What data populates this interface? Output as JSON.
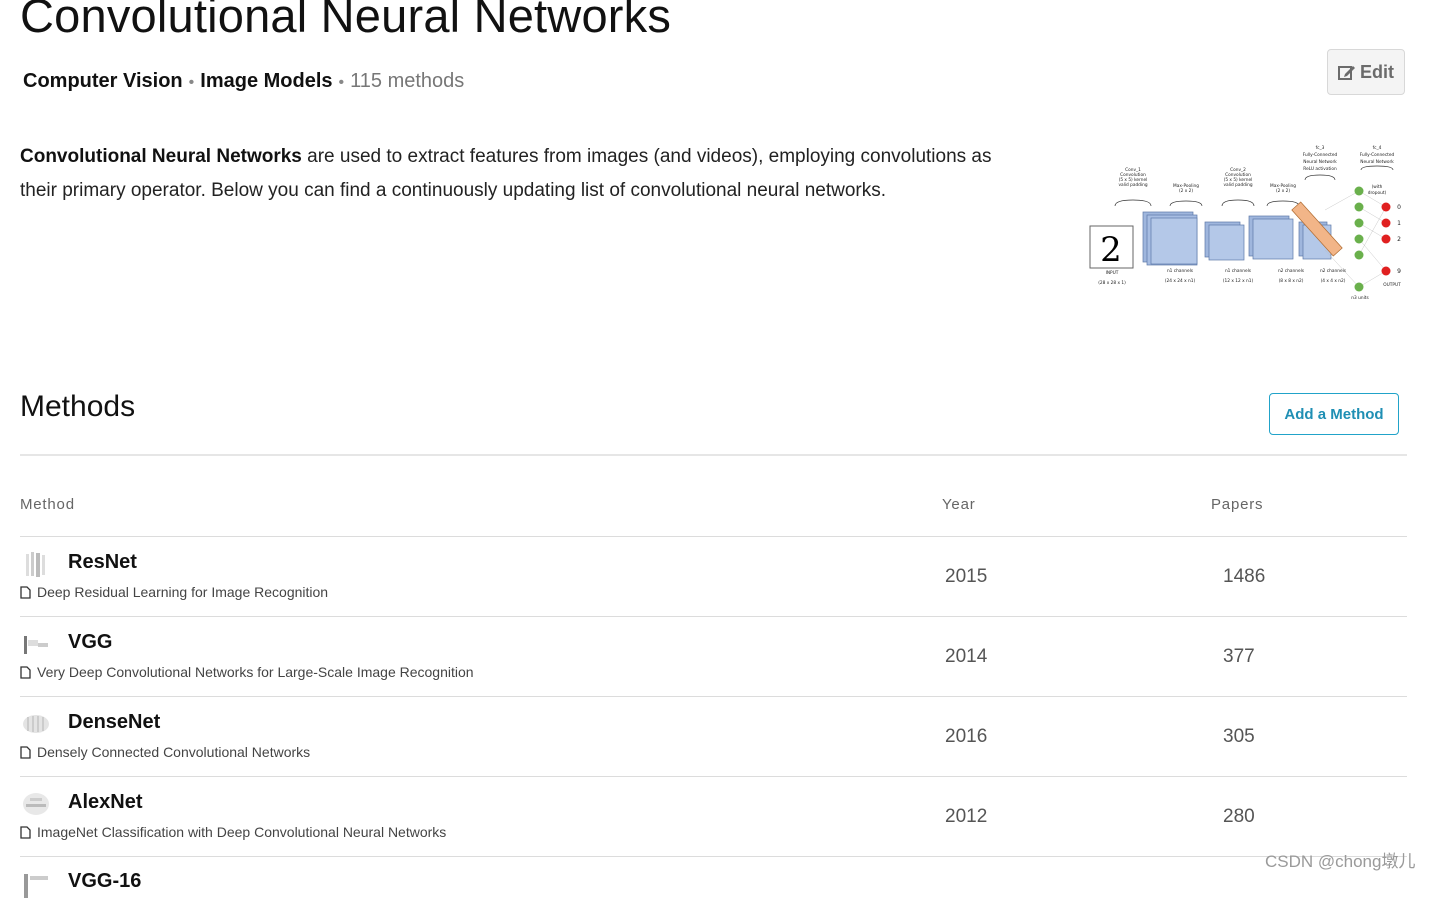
{
  "page": {
    "title": "Convolutional Neural Networks",
    "breadcrumb": [
      "Computer Vision",
      "Image Models"
    ],
    "method_count": "115 methods",
    "edit_label": "Edit"
  },
  "description": {
    "bold": "Convolutional Neural Networks",
    "text": " are used to extract features from images (and videos), employing convolutions as their primary operator. Below you can find a continuously updating list of convolutional neural networks."
  },
  "diagram": {
    "labels": [
      "Conv_1",
      "Convolution",
      "(5 x 5) kernel",
      "valid padding",
      "Max-Pooling",
      "(2 x 2)",
      "Conv_2",
      "Convolution",
      "(5 x 5) kernel",
      "valid padding",
      "Max-Pooling",
      "(2 x 2)",
      "fc_3",
      "Fully-Connected",
      "Neural Network",
      "ReLU activation",
      "fc_4",
      "Fully-Connected",
      "Neural Network",
      "(with",
      "dropout)",
      "INPUT",
      "(28 x 28 x 1)",
      "n1 channels",
      "(24 x 24 x n1)",
      "n1 channels",
      "(12 x 12 x n1)",
      "n2 channels",
      "(8 x 8 x n2)",
      "n2 channels",
      "(4 x 4 x n2)",
      "OUTPUT",
      "n3 units",
      "0",
      "1",
      "2",
      "9"
    ]
  },
  "methods": {
    "heading": "Methods",
    "add_label": "Add a Method",
    "columns": {
      "method": "Method",
      "year": "Year",
      "papers": "Papers"
    },
    "rows": [
      {
        "name": "ResNet",
        "paper": "Deep Residual Learning for Image Recognition",
        "year": "2015",
        "papers": "1486"
      },
      {
        "name": "VGG",
        "paper": "Very Deep Convolutional Networks for Large-Scale Image Recognition",
        "year": "2014",
        "papers": "377"
      },
      {
        "name": "DenseNet",
        "paper": "Densely Connected Convolutional Networks",
        "year": "2016",
        "papers": "305"
      },
      {
        "name": "AlexNet",
        "paper": "ImageNet Classification with Deep Convolutional Neural Networks",
        "year": "2012",
        "papers": "280"
      }
    ],
    "partial_row_name": "VGG-16"
  },
  "watermark": "CSDN @chong墩儿",
  "colors": {
    "accent": "#1f8fb4",
    "diagram_block": "#9fb6dd",
    "node_green": "#6ab04c",
    "node_red": "#e02020"
  }
}
